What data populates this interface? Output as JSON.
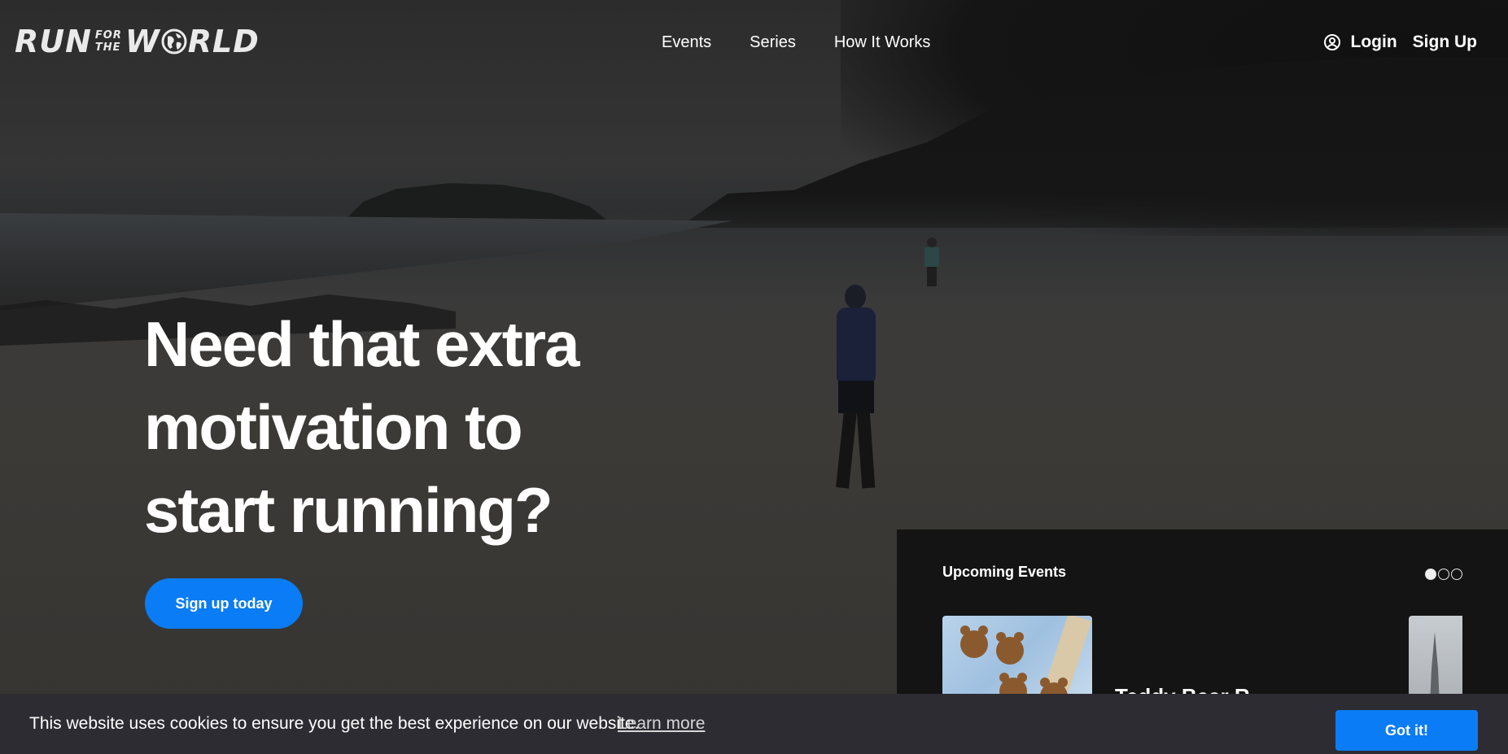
{
  "nav": {
    "logo": {
      "run": "RUN",
      "for": "FOR",
      "the": "THE",
      "world": "W RLD"
    },
    "links": [
      "Events",
      "Series",
      "How It Works"
    ],
    "login": "Login",
    "signup": "Sign Up"
  },
  "hero": {
    "headline_lines": [
      "Need that extra",
      "motivation to",
      "start running?"
    ],
    "cta": "Sign up today"
  },
  "events": {
    "title": "Upcoming Events",
    "pagination": {
      "total": 3,
      "active": 1
    },
    "first_event_name": "Teddy Bear R..."
  },
  "cookie": {
    "message": "This website uses cookies to ensure you get the best experience on our website.",
    "learn_more": "Learn more",
    "accept": "Got it!"
  },
  "colors": {
    "accent": "#0a7cf5",
    "cookie_bg": "#2d2c33",
    "panel_bg": "#141414"
  },
  "icons": [
    "globe-icon",
    "user-circle-icon"
  ]
}
